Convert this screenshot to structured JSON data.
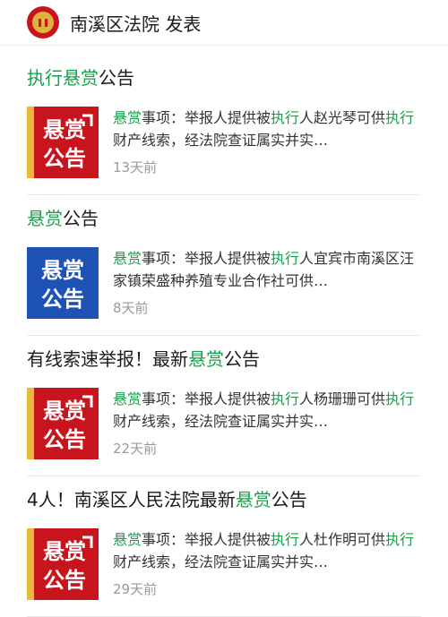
{
  "header": {
    "account_name": "南溪区法院",
    "action": "发表"
  },
  "colors": {
    "highlight": "#18a04b",
    "red_banner": "#c8151d",
    "blue_banner": "#1e52b5"
  },
  "posts": [
    {
      "title_parts": [
        {
          "text": "执行",
          "hl": true
        },
        {
          "text": "悬赏",
          "hl": true
        },
        {
          "text": "公告",
          "hl": false
        }
      ],
      "thumb": {
        "style": "red",
        "line1": "悬赏",
        "line2": "公告"
      },
      "excerpt_parts": [
        {
          "text": "悬赏",
          "hl": true
        },
        {
          "text": "事项：举报人提供被",
          "hl": false
        },
        {
          "text": "执行",
          "hl": true
        },
        {
          "text": "人赵光琴可供",
          "hl": false
        },
        {
          "text": "执行",
          "hl": true
        },
        {
          "text": "财产线索，经法院查证属实并实…",
          "hl": false
        }
      ],
      "time": "13天前"
    },
    {
      "title_parts": [
        {
          "text": "悬赏",
          "hl": true
        },
        {
          "text": "公告",
          "hl": false
        }
      ],
      "thumb": {
        "style": "blue",
        "line1": "悬赏",
        "line2": "公告"
      },
      "excerpt_parts": [
        {
          "text": "悬赏",
          "hl": true
        },
        {
          "text": "事项：举报人提供被",
          "hl": false
        },
        {
          "text": "执行",
          "hl": true
        },
        {
          "text": "人宜宾市南溪区汪家镇荣盛种养殖专业合作社可供…",
          "hl": false
        }
      ],
      "time": "8天前"
    },
    {
      "title_parts": [
        {
          "text": "有线索速举报！最新",
          "hl": false
        },
        {
          "text": "悬赏",
          "hl": true
        },
        {
          "text": "公告",
          "hl": false
        }
      ],
      "thumb": {
        "style": "red",
        "line1": "悬赏",
        "line2": "公告"
      },
      "excerpt_parts": [
        {
          "text": "悬赏",
          "hl": true
        },
        {
          "text": "事项：举报人提供被",
          "hl": false
        },
        {
          "text": "执行",
          "hl": true
        },
        {
          "text": "人杨珊珊可供",
          "hl": false
        },
        {
          "text": "执行",
          "hl": true
        },
        {
          "text": "财产线索，经法院查证属实并实…",
          "hl": false
        }
      ],
      "time": "22天前"
    },
    {
      "title_parts": [
        {
          "text": "4人！南溪区人民法院最新",
          "hl": false
        },
        {
          "text": "悬赏",
          "hl": true
        },
        {
          "text": "公告",
          "hl": false
        }
      ],
      "thumb": {
        "style": "red",
        "line1": "悬赏",
        "line2": "公告"
      },
      "excerpt_parts": [
        {
          "text": "悬赏",
          "hl": true
        },
        {
          "text": "事项：举报人提供被",
          "hl": false
        },
        {
          "text": "执行",
          "hl": true
        },
        {
          "text": "人杜作明可供",
          "hl": false
        },
        {
          "text": "执行",
          "hl": true
        },
        {
          "text": "财产线索，经法院查证属实并实…",
          "hl": false
        }
      ],
      "time": "29天前"
    }
  ]
}
